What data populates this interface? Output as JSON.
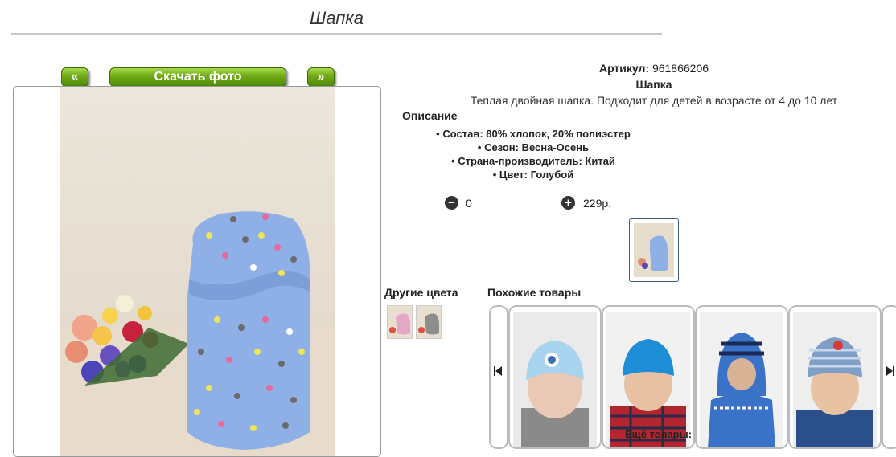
{
  "page": {
    "title": "Шапка",
    "prev_label": "«",
    "download_label": "Скачать фото",
    "next_label": "»"
  },
  "product": {
    "sku_label": "Артикул:",
    "sku_value": "961866206",
    "name": "Шапка",
    "description": "Теплая двойная шапка. Подходит для детей в возрасте от 4 до 10 лет",
    "description_heading": "Описание",
    "properties": [
      "Состав: 80% хлопок, 20% полиэстер",
      "Сезон: Весна-Осень",
      "Страна-производитель: Китай",
      "Цвет: Голубой"
    ],
    "quantity": "0",
    "price": "229р."
  },
  "other_colors": {
    "heading": "Другие цвета",
    "swatches": [
      "pink",
      "grey"
    ]
  },
  "similar": {
    "heading": "Похожие товары",
    "more_label": "Ещё товары:"
  },
  "colors": {
    "button_green": "#6faa16",
    "hat_blue": "#8fb0e6",
    "thumb_border": "#3b5b8c"
  }
}
